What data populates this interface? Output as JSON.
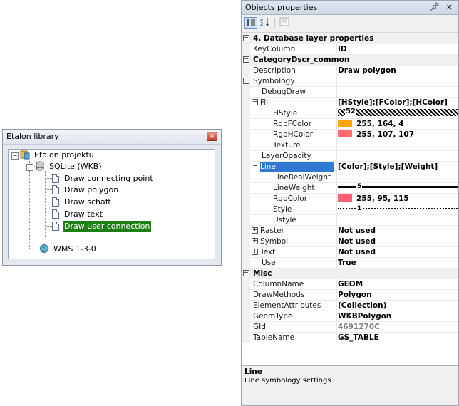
{
  "etalon": {
    "title": "Etalon library",
    "tree": {
      "root": "Etalon projektu",
      "db": "SQLite (WKB)",
      "items": [
        "Draw connecting point",
        "Draw polygon",
        "Draw schaft",
        "Draw text",
        "Draw user connection"
      ],
      "selected_item": "Draw user connection",
      "service": "WMS 1-3-0"
    }
  },
  "properties": {
    "title": "Objects properties",
    "pin_glyph": "P",
    "close_glyph": "×",
    "toolbar": [
      "categorized-view",
      "alphabetical-view",
      "property-pages"
    ],
    "rows": [
      {
        "kind": "cat",
        "expander": "⊟",
        "name": "4. Database layer properties"
      },
      {
        "name": "KeyColumn",
        "value": "ID"
      },
      {
        "kind": "cat",
        "expander": "⊟",
        "name": "CategoryDscr_common"
      },
      {
        "name": "Description",
        "value": "Draw polygon"
      },
      {
        "kind": "group",
        "expander": "⊟",
        "name": "Symbology"
      },
      {
        "indent": 1,
        "name": "DebugDraw",
        "value": ""
      },
      {
        "kind": "group",
        "indent": 1,
        "expander": "⊟",
        "name": "Fill",
        "value": "[HStyle];[FColor];[HColor]"
      },
      {
        "indent": 2,
        "name": "HStyle",
        "value": "52",
        "special": "hatch"
      },
      {
        "indent": 2,
        "name": "RgbFColor",
        "value": "255, 164, 4",
        "swatch": "#ffa404"
      },
      {
        "indent": 2,
        "name": "RgbHColor",
        "value": "255, 107, 107",
        "swatch": "#ff6b6b"
      },
      {
        "indent": 2,
        "name": "Texture",
        "value": ""
      },
      {
        "indent": 1,
        "name": "LayerOpacity",
        "value": ""
      },
      {
        "kind": "group",
        "indent": 1,
        "expander": "⊟",
        "name": "Line",
        "value": "[Color];[Style];[Weight]",
        "selected": true
      },
      {
        "indent": 2,
        "name": "LineRealWeight",
        "value": ""
      },
      {
        "indent": 2,
        "name": "LineWeight",
        "value": "5",
        "special": "weight"
      },
      {
        "indent": 2,
        "name": "RgbColor",
        "value": "255, 95, 115",
        "swatch": "#ff5f73"
      },
      {
        "indent": 2,
        "name": "Style",
        "value": "1",
        "special": "dots"
      },
      {
        "indent": 2,
        "name": "Ustyle",
        "value": ""
      },
      {
        "kind": "group",
        "indent": 1,
        "expander": "⊞",
        "name": "Raster",
        "value": "Not used"
      },
      {
        "kind": "group",
        "indent": 1,
        "expander": "⊞",
        "name": "Symbol",
        "value": "Not used"
      },
      {
        "kind": "group",
        "indent": 1,
        "expander": "⊞",
        "name": "Text",
        "value": "Not used"
      },
      {
        "indent": 1,
        "name": "Use",
        "value": "True"
      },
      {
        "kind": "cat",
        "expander": "⊟",
        "name": "Misc"
      },
      {
        "name": "ColumnName",
        "value": "GEOM"
      },
      {
        "name": "DrawMethods",
        "value": "Polygon"
      },
      {
        "name": "ElementAttributes",
        "value": "(Collection)"
      },
      {
        "name": "GeomType",
        "value": "WKBPolygon"
      },
      {
        "name": "GId",
        "value": "4691270C",
        "dim": true
      },
      {
        "name": "TableName",
        "value": "GS_TABLE"
      }
    ],
    "description": {
      "title": "Line",
      "text": "Line symbology settings"
    }
  },
  "colors": {
    "selection_tree": "#1e7f15",
    "selection_grid": "#3178d3"
  }
}
